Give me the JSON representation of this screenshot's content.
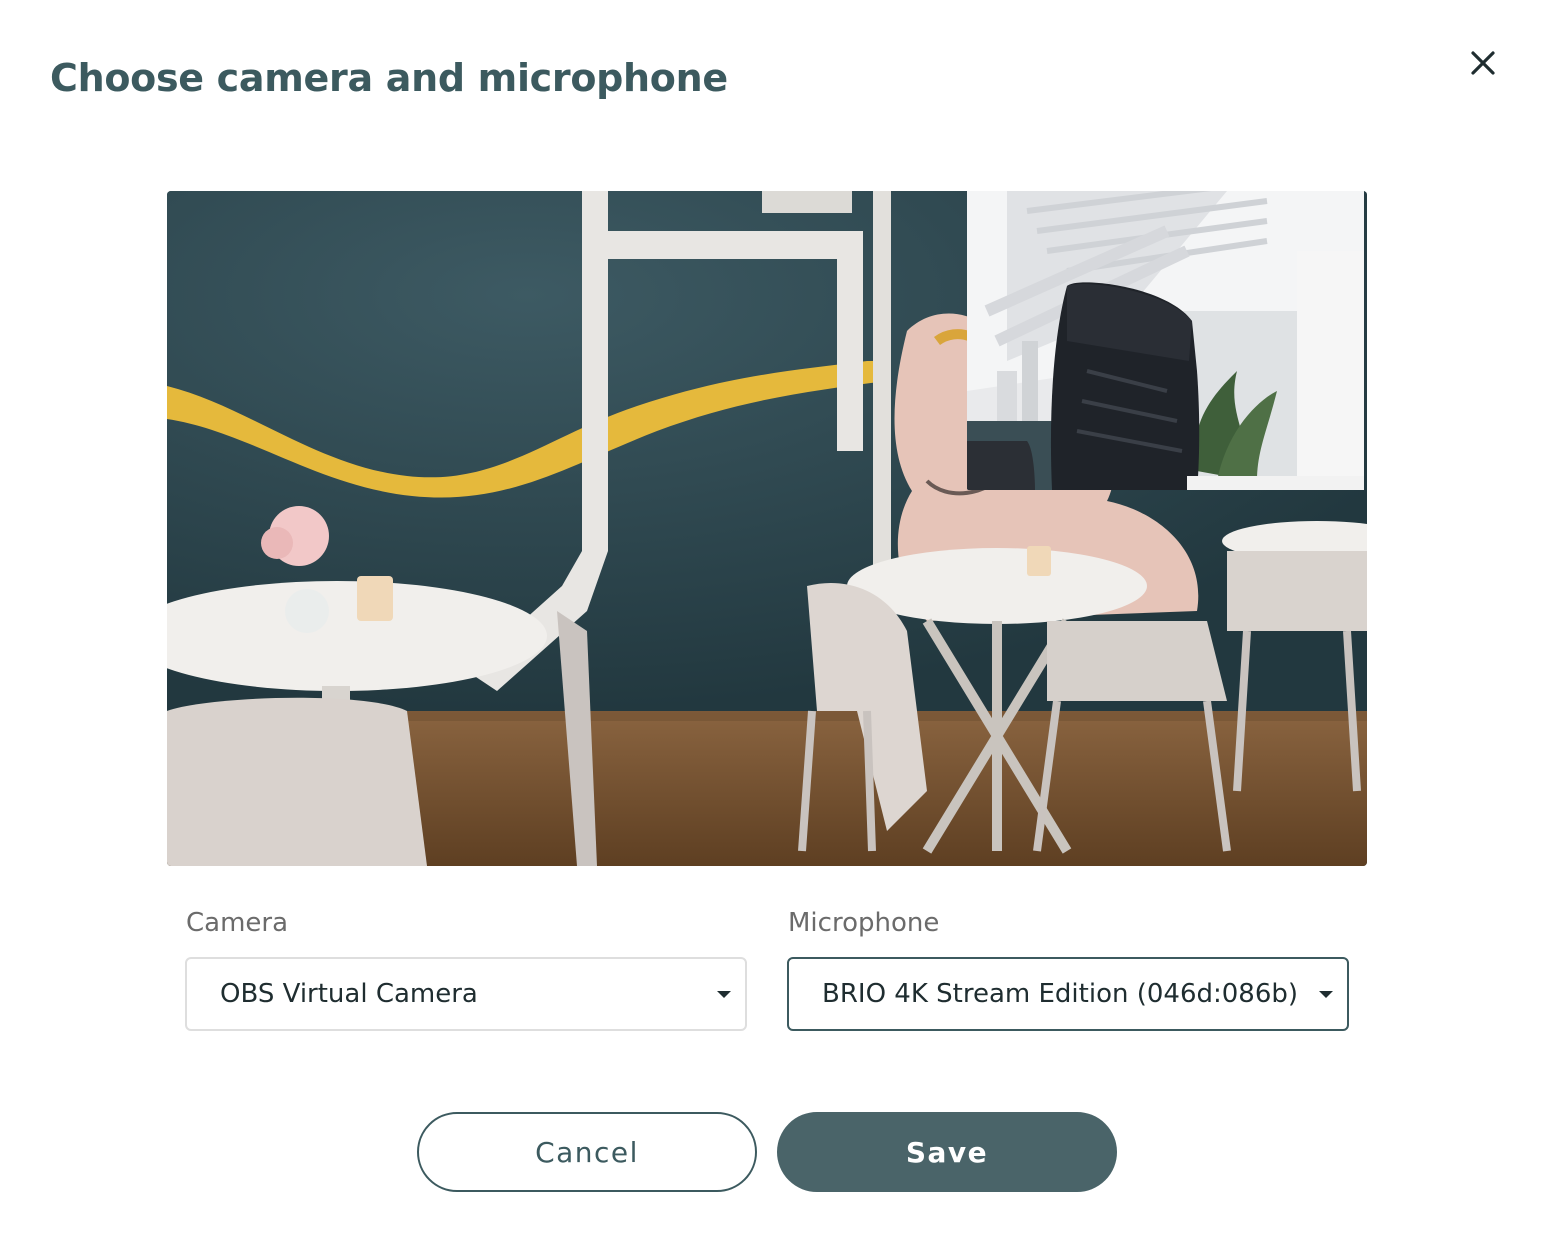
{
  "dialog": {
    "title": "Choose camera and microphone",
    "close_icon": "close-icon"
  },
  "preview": {
    "main_scene": "cafe-interior",
    "pip_scene": "office-chair"
  },
  "camera": {
    "label": "Camera",
    "selected": "OBS Virtual Camera"
  },
  "microphone": {
    "label": "Microphone",
    "selected": "BRIO 4K Stream Edition (046d:086b)"
  },
  "actions": {
    "cancel_label": "Cancel",
    "save_label": "Save"
  },
  "colors": {
    "accent": "#3c5a5f",
    "save_bg": "#4a6469",
    "text": "#1f2d30"
  }
}
